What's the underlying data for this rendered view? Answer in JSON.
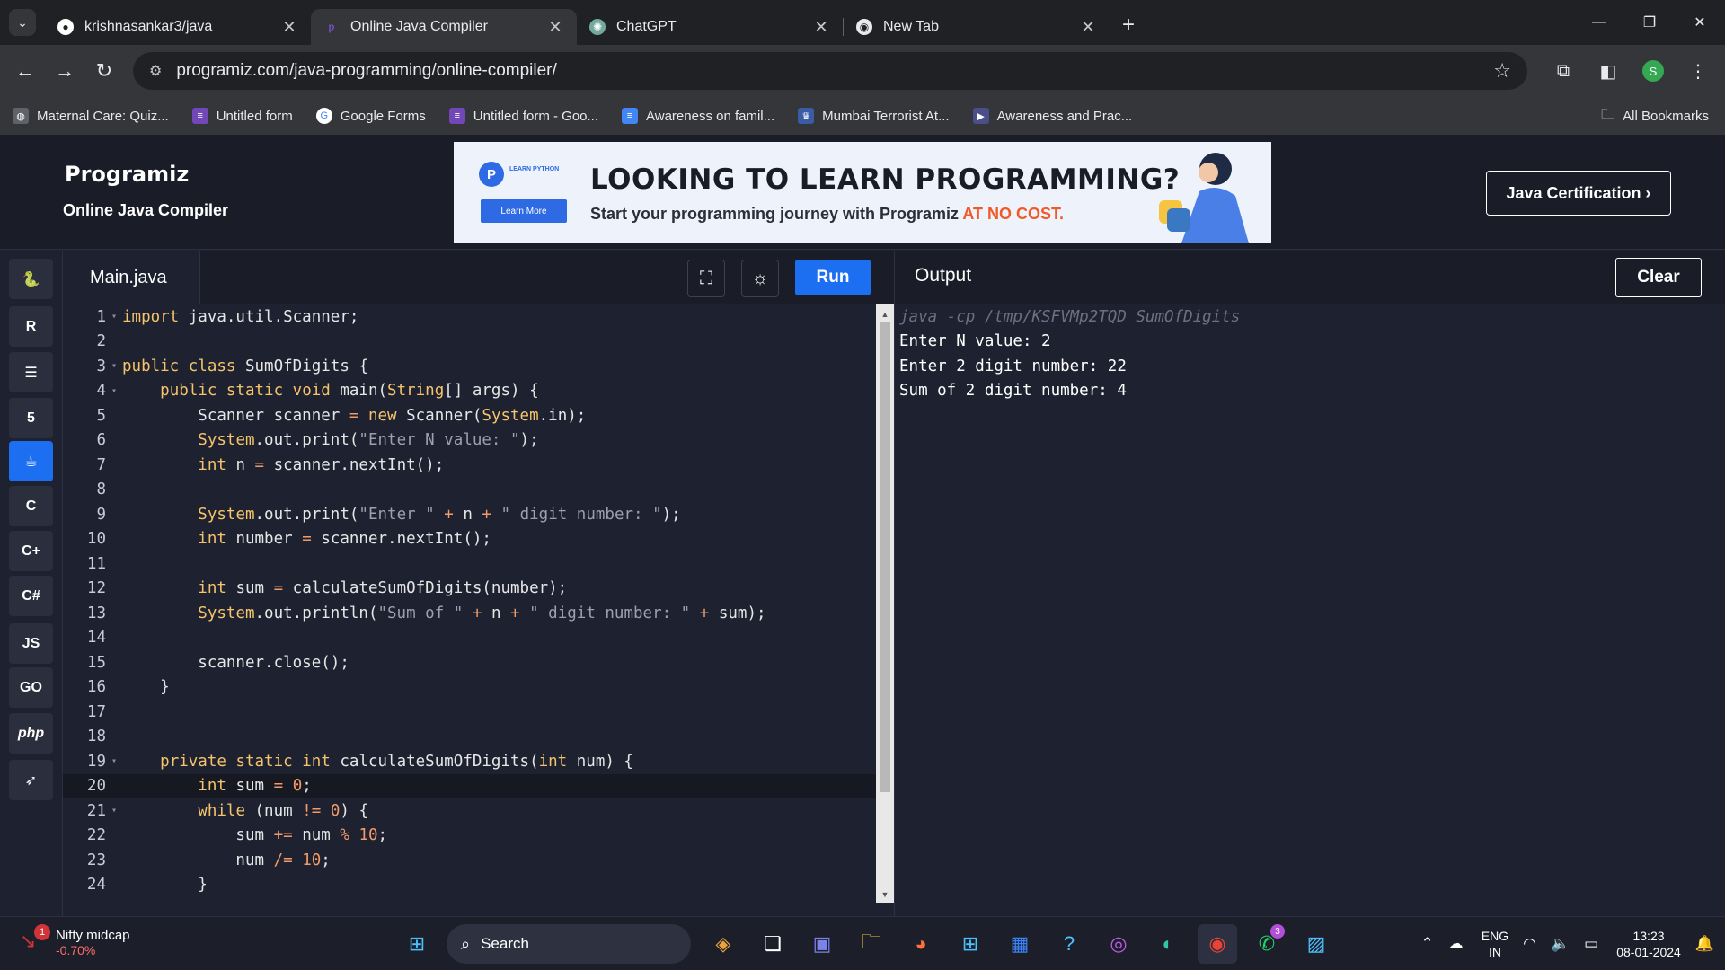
{
  "browser": {
    "tabs": [
      {
        "title": "krishnasankar3/java",
        "favicon": "github-icon"
      },
      {
        "title": "Online Java Compiler",
        "favicon": "programiz-icon"
      },
      {
        "title": "ChatGPT",
        "favicon": "chatgpt-icon"
      },
      {
        "title": "New Tab",
        "favicon": "chrome-icon"
      }
    ],
    "url": "programiz.com/java-programming/online-compiler/",
    "profile_initial": "S",
    "bookmarks": [
      "Maternal Care: Quiz...",
      "Untitled form",
      "Google Forms",
      "Untitled form - Goo...",
      "Awareness on famil...",
      "Mumbai Terrorist At...",
      "Awareness and Prac..."
    ],
    "all_bookmarks": "All Bookmarks"
  },
  "site": {
    "logo": "Programiz",
    "subtitle": "Online Java Compiler",
    "ad": {
      "small_label": "LEARN PYTHON",
      "learn_more": "Learn More",
      "headline": "LOOKING TO LEARN PROGRAMMING?",
      "sub_prefix": "Start your programming journey with Programiz ",
      "sub_highlight": "AT NO COST."
    },
    "certification_button": "Java Certification ›"
  },
  "rail": [
    "py",
    "R",
    "sql",
    "html",
    "java",
    "C",
    "C++",
    "C#",
    "JS",
    "GO",
    "php",
    "swift"
  ],
  "editor": {
    "file_tab": "Main.java",
    "run_label": "Run",
    "current_line": 20,
    "lines": [
      {
        "n": "1",
        "fold": true,
        "html": "<span class=\"kw\">import</span> java.util.Scanner;"
      },
      {
        "n": "2",
        "fold": false,
        "html": ""
      },
      {
        "n": "3",
        "fold": true,
        "html": "<span class=\"kw\">public class</span> SumOfDigits {"
      },
      {
        "n": "4",
        "fold": true,
        "html": "    <span class=\"kw\">public static void</span> main(<span class=\"kw\">String</span>[] args) {"
      },
      {
        "n": "5",
        "fold": false,
        "html": "        Scanner scanner <span class=\"op\">=</span> <span class=\"kw\">new</span> Scanner(<span class=\"kw\">System</span>.in);"
      },
      {
        "n": "6",
        "fold": false,
        "html": "        <span class=\"kw\">System</span>.out.print(<span class=\"st\">\"Enter N value: \"</span>);"
      },
      {
        "n": "7",
        "fold": false,
        "html": "        <span class=\"kw\">int</span> n <span class=\"op\">=</span> scanner.nextInt();"
      },
      {
        "n": "8",
        "fold": false,
        "html": ""
      },
      {
        "n": "9",
        "fold": false,
        "html": "        <span class=\"kw\">System</span>.out.print(<span class=\"st\">\"Enter \"</span> <span class=\"op\">+</span> n <span class=\"op\">+</span> <span class=\"st\">\" digit number: \"</span>);"
      },
      {
        "n": "10",
        "fold": false,
        "html": "        <span class=\"kw\">int</span> number <span class=\"op\">=</span> scanner.nextInt();"
      },
      {
        "n": "11",
        "fold": false,
        "html": ""
      },
      {
        "n": "12",
        "fold": false,
        "html": "        <span class=\"kw\">int</span> sum <span class=\"op\">=</span> calculateSumOfDigits(number);"
      },
      {
        "n": "13",
        "fold": false,
        "html": "        <span class=\"kw\">System</span>.out.println(<span class=\"st\">\"Sum of \"</span> <span class=\"op\">+</span> n <span class=\"op\">+</span> <span class=\"st\">\" digit number: \"</span> <span class=\"op\">+</span> sum);"
      },
      {
        "n": "14",
        "fold": false,
        "html": ""
      },
      {
        "n": "15",
        "fold": false,
        "html": "        scanner.close();"
      },
      {
        "n": "16",
        "fold": false,
        "html": "    }"
      },
      {
        "n": "17",
        "fold": false,
        "html": ""
      },
      {
        "n": "18",
        "fold": false,
        "html": ""
      },
      {
        "n": "19",
        "fold": true,
        "html": "    <span class=\"kw\">private static int</span> calculateSumOfDigits(<span class=\"kw\">int</span> num) {"
      },
      {
        "n": "20",
        "fold": false,
        "html": "        <span class=\"kw\">int</span> sum <span class=\"op\">=</span> <span class=\"nm\">0</span>;"
      },
      {
        "n": "21",
        "fold": true,
        "html": "        <span class=\"kw\">while</span> (num <span class=\"op\">!=</span> <span class=\"nm\">0</span>) {"
      },
      {
        "n": "22",
        "fold": false,
        "html": "            sum <span class=\"op\">+=</span> num <span class=\"op\">%</span> <span class=\"nm\">10</span>;"
      },
      {
        "n": "23",
        "fold": false,
        "html": "            num <span class=\"op\">/=</span> <span class=\"nm\">10</span>;"
      },
      {
        "n": "24",
        "fold": false,
        "html": "        }"
      }
    ]
  },
  "output": {
    "title": "Output",
    "clear_label": "Clear",
    "lines": [
      "java -cp /tmp/KSFVMp2TQD SumOfDigits",
      "Enter N value: 2",
      "Enter 2 digit number: 22",
      "Sum of 2 digit number: 4"
    ]
  },
  "taskbar": {
    "ticker_name": "Nifty midcap",
    "ticker_change": "-0.70%",
    "ticker_badge": "1",
    "search_placeholder": "Search",
    "whatsapp_badge": "3",
    "lang_top": "ENG",
    "lang_bottom": "IN",
    "time": "13:23",
    "date": "08-01-2024"
  }
}
